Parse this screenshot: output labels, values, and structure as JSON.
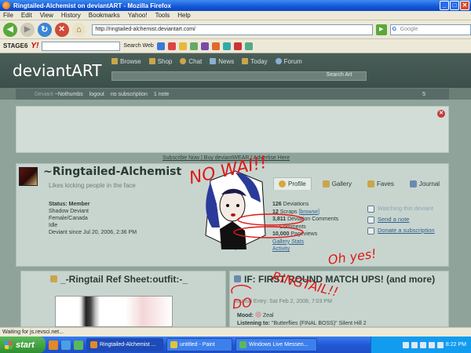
{
  "window": {
    "title": "Ringtailed-Alchemist on deviantART - Mozilla Firefox",
    "min": "_",
    "max": "□",
    "close": "✕"
  },
  "menu": [
    "File",
    "Edit",
    "View",
    "History",
    "Bookmarks",
    "Yahoo!",
    "Tools",
    "Help"
  ],
  "nav": {
    "url": "http://ringtailed-alchemist.deviantart.com/",
    "google_placeholder": "Google"
  },
  "toolbar3": {
    "stage6": "STAGE6",
    "yahoo": "Y!",
    "search_web": "Search Web"
  },
  "da": {
    "logo": "deviantART",
    "nav": [
      "Browse",
      "Shop",
      "Chat",
      "News",
      "Today",
      "Forum"
    ],
    "search_btn": "Search Art",
    "userbar": {
      "deviant": "Deviant",
      "user": "~Nothumbs",
      "logout": "logout",
      "subscription": "no subscription",
      "notes": "1 note",
      "counter": "5"
    },
    "subscribe_line": "Subscribe Now | Buy deviantWEAR | Advertise Here"
  },
  "profile": {
    "username": "~Ringtailed-Alchemist",
    "tagline": "Likes kicking people in the face",
    "tabs": [
      "Profile",
      "Gallery",
      "Faves",
      "Journal"
    ],
    "status": {
      "label": "Status: Member",
      "line2": "Shadow Deviant",
      "line3": "Female/Canada",
      "line4": "Idle",
      "line5": "Deviant since Jul 20, 2006, 2:36 PM"
    },
    "stats": {
      "deviations_num": "126",
      "deviations_label": "Deviations",
      "scraps_num": "12",
      "scraps_label": "Scraps",
      "browse": "[browse]",
      "devcomments_num": "3,811",
      "devcomments_label": "Deviation Comments",
      "devcomments2_num": "—",
      "devcomments2_label": "Comments",
      "pageviews_num": "10,000",
      "pageviews_label": "Pageviews",
      "gallery_stats": "Gallery Stats",
      "activity": "Activity"
    },
    "links": {
      "watching": "Watching this deviant",
      "send_note": "Send a note",
      "donate": "Donate a subscription"
    }
  },
  "box1": {
    "title": "_-Ringtail Ref Sheet:outfit:-_"
  },
  "box2": {
    "title": "IF: FIRST ROUND MATCH UPS! (and more)",
    "meta": "Journal Entry: Sat Feb 2, 2008, 7:03 PM",
    "mood_label": "Mood:",
    "mood_value": "Zeal",
    "listening_label": "Listening to:",
    "listening_value": "\"Butterflies (FINAL BOSS)\" Silent Hill 2"
  },
  "statusbar": {
    "text": "Waiting for js.revsci.net..."
  },
  "taskbar": {
    "start": "start",
    "tasks": [
      "Ringtailed-Alchemist ...",
      "untitled - Paint",
      "Windows Live Messen..."
    ],
    "clock": "8:22 PM"
  },
  "scribbles": {
    "nowai": "NO WAI!!",
    "ohyes": "Oh yes!",
    "ringtail": "RINGTAIL!!",
    "do": "DO"
  }
}
